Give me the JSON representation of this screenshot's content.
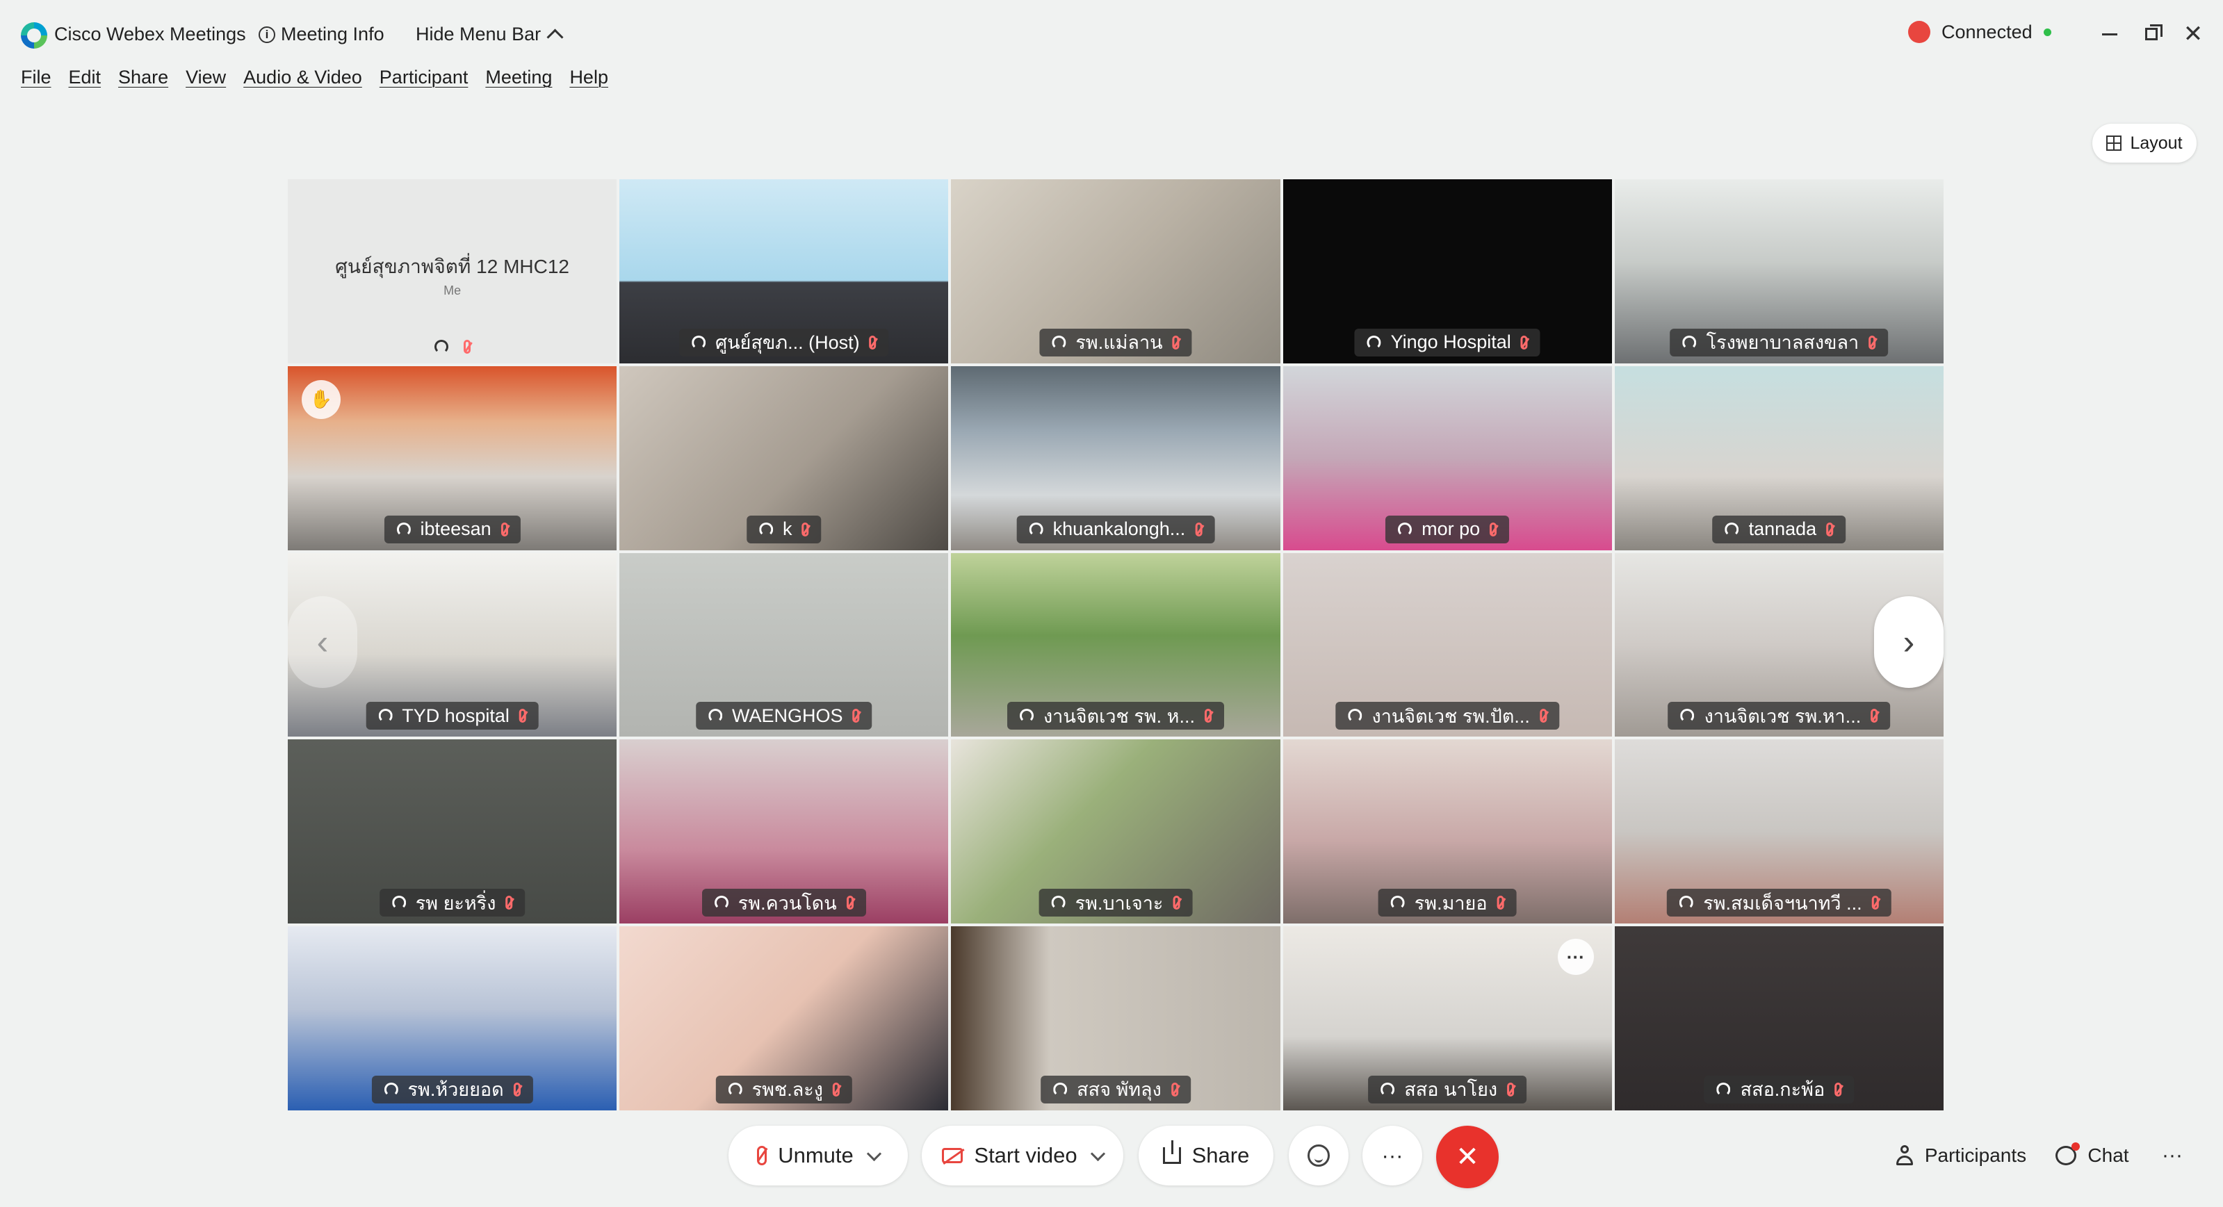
{
  "titlebar": {
    "app_title": "Cisco Webex Meetings",
    "meeting_info": "Meeting Info",
    "hide_menu_bar": "Hide Menu Bar",
    "connected": "Connected",
    "connected_color": "#2fbf4a",
    "recording_color": "#e8463f"
  },
  "menu": [
    "File",
    "Edit",
    "Share",
    "View",
    "Audio & Video",
    "Participant",
    "Meeting",
    "Help"
  ],
  "layout_button": "Layout",
  "self_tile": {
    "name": "ศูนย์สุขภาพจิตที่ 12 MHC12",
    "sub": "Me"
  },
  "participants": [
    {
      "name": "ศูนย์สุขภ... (Host)",
      "active": true,
      "scene": "slide"
    },
    {
      "name": "รพ.แม่ลาน",
      "scene": "office"
    },
    {
      "name": "Yingo Hospital",
      "scene": "black"
    },
    {
      "name": "โรงพยาบาลสงขลา",
      "scene": "room"
    },
    {
      "name": "ibteesan",
      "scene": "group"
    },
    {
      "name": "k",
      "scene": "office2"
    },
    {
      "name": "khuankalongh...",
      "scene": "shelf"
    },
    {
      "name": "mor po",
      "scene": "pink"
    },
    {
      "name": "tannada",
      "scene": "room2"
    },
    {
      "name": "TYD hospital",
      "scene": "group2"
    },
    {
      "name": "WAENGHOS",
      "scene": "plain"
    },
    {
      "name": "งานจิตเวช รพ. ห...",
      "scene": "trees"
    },
    {
      "name": "งานจิตเวช รพ.ปัต...",
      "scene": "plain2"
    },
    {
      "name": "งานจิตเวช รพ.หา...",
      "scene": "room3"
    },
    {
      "name": "รพ ยะหริ่ง",
      "scene": "dark"
    },
    {
      "name": "รพ.ควนโดน",
      "scene": "pink2"
    },
    {
      "name": "รพ.บาเจาะ",
      "scene": "shelf2"
    },
    {
      "name": "รพ.มายอ",
      "scene": "group3"
    },
    {
      "name": "รพ.สมเด็จฯนาทวี ...",
      "scene": "nurse"
    },
    {
      "name": "รพ.ห้วยยอด",
      "scene": "blue"
    },
    {
      "name": "รพช.ละงู",
      "scene": "wall"
    },
    {
      "name": "สสจ พัทลุง",
      "scene": "office3"
    },
    {
      "name": "สสอ นาโยง",
      "scene": "board"
    },
    {
      "name": "สสอ.กะพ้อ",
      "scene": "dark2"
    }
  ],
  "controls": {
    "unmute": "Unmute",
    "start_video": "Start video",
    "share": "Share",
    "participants": "Participants",
    "chat": "Chat",
    "leave_color": "#e8322c"
  }
}
